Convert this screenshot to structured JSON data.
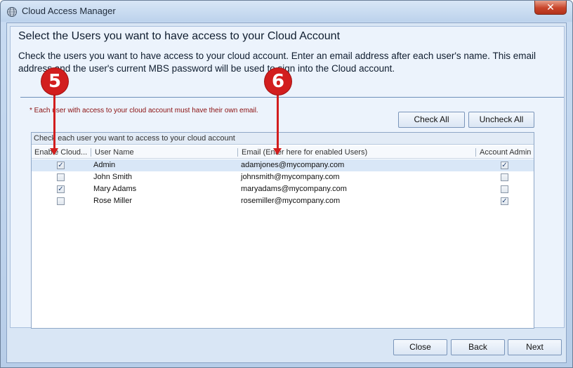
{
  "window": {
    "title": "Cloud Access Manager",
    "close_label": "✕"
  },
  "header": {
    "title": "Select the Users you want to have access to your Cloud Account",
    "instructions": "Check the users you want to have access to your cloud account. Enter an email address after each user's name. This email address and the user's current MBS password will be used to sign into the Cloud account."
  },
  "note": "* Each user with access to your cloud account must have their own email.",
  "buttons": {
    "check_all": "Check All",
    "uncheck_all": "Uncheck All",
    "close": "Close",
    "back": "Back",
    "next": "Next"
  },
  "grid": {
    "caption": "Check each user you want to access to your cloud account",
    "columns": [
      "Enable Cloud...",
      "User Name",
      "Email (Enter here for enabled Users)",
      "Account Admin"
    ],
    "rows": [
      {
        "enabled": true,
        "user": "Admin",
        "email": "adamjones@mycompany.com",
        "admin": true,
        "selected": true
      },
      {
        "enabled": false,
        "user": "John Smith",
        "email": "johnsmith@mycompany.com",
        "admin": false,
        "selected": false
      },
      {
        "enabled": true,
        "user": "Mary Adams",
        "email": "maryadams@mycompany.com",
        "admin": false,
        "selected": false
      },
      {
        "enabled": false,
        "user": "Rose Miller",
        "email": "rosemiller@mycompany.com",
        "admin": true,
        "selected": false
      }
    ]
  },
  "callouts": {
    "first": "5",
    "second": "6"
  },
  "colors": {
    "callout": "#d21e1e",
    "note_text": "#8b0f0f",
    "selected_row": "#d9e7f7"
  }
}
